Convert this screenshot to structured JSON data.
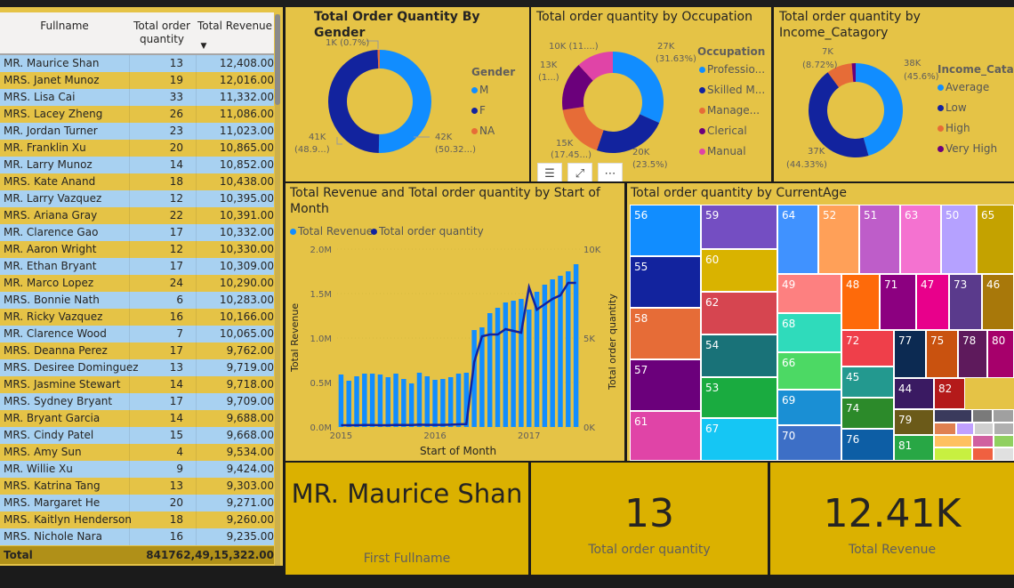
{
  "table": {
    "headers": {
      "name": "Fullname",
      "qty": "Total order quantity",
      "rev": "Total Revenue"
    },
    "rows": [
      [
        "MR. Maurice Shan",
        "13",
        "12,408.00"
      ],
      [
        "MRS. Janet Munoz",
        "19",
        "12,016.00"
      ],
      [
        "MRS. Lisa Cai",
        "33",
        "11,332.00"
      ],
      [
        "MRS. Lacey Zheng",
        "26",
        "11,086.00"
      ],
      [
        "MR. Jordan Turner",
        "23",
        "11,023.00"
      ],
      [
        "MR. Franklin Xu",
        "20",
        "10,865.00"
      ],
      [
        "MR. Larry Munoz",
        "14",
        "10,852.00"
      ],
      [
        "MRS. Kate Anand",
        "18",
        "10,438.00"
      ],
      [
        "MR. Larry Vazquez",
        "12",
        "10,395.00"
      ],
      [
        "MRS. Ariana Gray",
        "22",
        "10,391.00"
      ],
      [
        "MR. Clarence Gao",
        "17",
        "10,332.00"
      ],
      [
        "MR. Aaron Wright",
        "12",
        "10,330.00"
      ],
      [
        "MR. Ethan Bryant",
        "17",
        "10,309.00"
      ],
      [
        "MR. Marco Lopez",
        "24",
        "10,290.00"
      ],
      [
        "MRS. Bonnie Nath",
        "6",
        "10,283.00"
      ],
      [
        "MR. Ricky Vazquez",
        "16",
        "10,166.00"
      ],
      [
        "MR. Clarence Wood",
        "7",
        "10,065.00"
      ],
      [
        "MRS. Deanna Perez",
        "17",
        "9,762.00"
      ],
      [
        "MRS. Desiree Dominguez",
        "13",
        "9,719.00"
      ],
      [
        "MRS. Jasmine Stewart",
        "14",
        "9,718.00"
      ],
      [
        "MRS. Sydney Bryant",
        "17",
        "9,709.00"
      ],
      [
        "MR. Bryant Garcia",
        "14",
        "9,688.00"
      ],
      [
        "MRS. Cindy Patel",
        "15",
        "9,668.00"
      ],
      [
        "MRS. Amy Sun",
        "4",
        "9,534.00"
      ],
      [
        "MR. Willie Xu",
        "9",
        "9,424.00"
      ],
      [
        "MRS. Katrina Tang",
        "13",
        "9,303.00"
      ],
      [
        "MRS. Margaret He",
        "20",
        "9,271.00"
      ],
      [
        "MRS. Kaitlyn Henderson",
        "18",
        "9,260.00"
      ],
      [
        "MRS. Nichole Nara",
        "16",
        "9,235.00"
      ]
    ],
    "total": {
      "label": "Total",
      "qty": "84176",
      "rev": "2,49,15,322.00"
    }
  },
  "gender": {
    "title": "Total Order Quantity By Gender",
    "legend_title": "Gender",
    "legend": [
      {
        "name": "M",
        "color": "#118dff"
      },
      {
        "name": "F",
        "color": "#12239e"
      },
      {
        "name": "NA",
        "color": "#e66c37"
      }
    ],
    "labels": {
      "na": "1K (0.7%)",
      "f_val": "41K",
      "f_pct": "(48.9...)",
      "m_val": "42K",
      "m_pct": "(50.32...)"
    }
  },
  "occupation": {
    "title": "Total order quantity by Occupation",
    "legend_title": "Occupation",
    "legend": [
      {
        "name": "Professio...",
        "color": "#118dff"
      },
      {
        "name": "Skilled M...",
        "color": "#12239e"
      },
      {
        "name": "Manage...",
        "color": "#e66c37"
      },
      {
        "name": "Clerical",
        "color": "#6b007b"
      },
      {
        "name": "Manual",
        "color": "#e044a7"
      }
    ],
    "labels": {
      "a": "10K (11....)",
      "b1": "27K",
      "b2": "(31.63%)",
      "c1": "13K",
      "c2": "(1...)",
      "d1": "15K",
      "d2": "(17.45...)",
      "e1": "20K",
      "e2": "(23.5%)"
    }
  },
  "income": {
    "title": "Total order quantity by Income_Catagory",
    "legend_title": "Income_Cata...",
    "legend": [
      {
        "name": "Average",
        "color": "#118dff"
      },
      {
        "name": "Low",
        "color": "#12239e"
      },
      {
        "name": "High",
        "color": "#e66c37"
      },
      {
        "name": "Very High",
        "color": "#6b007b"
      }
    ],
    "labels": {
      "a1": "7K",
      "a2": "(8.72%)",
      "b1": "38K",
      "b2": "(45.6%)",
      "c1": "37K",
      "c2": "(44.33%)"
    }
  },
  "combo": {
    "title": "Total Revenue and Total order quantity by Start of Month",
    "legend": [
      {
        "name": "Total Revenue",
        "color": "#118dff"
      },
      {
        "name": "Total order quantity",
        "color": "#12239e"
      }
    ],
    "ylabel_left": "Total Revenue",
    "ylabel_right": "Total order quantity",
    "xlabel": "Start of Month",
    "left_ticks": [
      "2.0M",
      "1.5M",
      "1.0M",
      "0.5M",
      "0.0M"
    ],
    "right_ticks": [
      "10K",
      "5K",
      "0K"
    ],
    "x_ticks": [
      "2015",
      "2016",
      "2017"
    ]
  },
  "chart_data": {
    "type": "bar",
    "title": "Total Revenue and Total order quantity by Start of Month",
    "xlabel": "Start of Month",
    "ylabel": "Total Revenue",
    "ylim": [
      0,
      2000000
    ],
    "y2lim": [
      0,
      10000
    ],
    "x_ticks": [
      "2015",
      "2016",
      "2017"
    ],
    "series": [
      {
        "name": "Total Revenue",
        "type": "bar",
        "values": [
          590000,
          520000,
          570000,
          600000,
          600000,
          590000,
          560000,
          600000,
          540000,
          490000,
          610000,
          570000,
          530000,
          540000,
          560000,
          600000,
          610000,
          1090000,
          1120000,
          1280000,
          1340000,
          1400000,
          1420000,
          1440000,
          1320000,
          1520000,
          1600000,
          1660000,
          1700000,
          1750000,
          1830000
        ]
      },
      {
        "name": "Total order quantity",
        "type": "line",
        "values": [
          100,
          100,
          100,
          110,
          110,
          100,
          100,
          120,
          110,
          110,
          130,
          120,
          120,
          120,
          130,
          150,
          160,
          3650,
          5100,
          5200,
          5200,
          5500,
          5400,
          5300,
          7850,
          6600,
          6900,
          7200,
          7400,
          8100,
          8100
        ]
      }
    ]
  },
  "age": {
    "title": "Total order quantity by CurrentAge",
    "cells": [
      {
        "label": "56",
        "color": "#118dff"
      },
      {
        "label": "55",
        "color": "#12239e"
      },
      {
        "label": "58",
        "color": "#e66c37"
      },
      {
        "label": "57",
        "color": "#6b007b"
      },
      {
        "label": "61",
        "color": "#e044a7"
      },
      {
        "label": "59",
        "color": "#744ec2"
      },
      {
        "label": "60",
        "color": "#d9b300"
      },
      {
        "label": "62",
        "color": "#d64550"
      },
      {
        "label": "54",
        "color": "#197278"
      },
      {
        "label": "53",
        "color": "#1aab40"
      },
      {
        "label": "67",
        "color": "#15c6f4"
      },
      {
        "label": "64",
        "color": "#4092ff"
      },
      {
        "label": "52",
        "color": "#ffa058"
      },
      {
        "label": "51",
        "color": "#be5dc9"
      },
      {
        "label": "63",
        "color": "#f472d0"
      },
      {
        "label": "50",
        "color": "#b5a1ff"
      },
      {
        "label": "65",
        "color": "#c4a200"
      },
      {
        "label": "49",
        "color": "#fd8080"
      },
      {
        "label": "48",
        "color": "#fe6a0a"
      },
      {
        "label": "71",
        "color": "#8c0080"
      },
      {
        "label": "47",
        "color": "#e8008b"
      },
      {
        "label": "73",
        "color": "#5a3a8c"
      },
      {
        "label": "46",
        "color": "#a8780a"
      },
      {
        "label": "68",
        "color": "#2fdbbb"
      },
      {
        "label": "66",
        "color": "#4cd964"
      },
      {
        "label": "69",
        "color": "#1a8fd4"
      },
      {
        "label": "70",
        "color": "#3d6fc6"
      },
      {
        "label": "72",
        "color": "#ef3f4a"
      },
      {
        "label": "77",
        "color": "#0c2a52"
      },
      {
        "label": "75",
        "color": "#c9520f"
      },
      {
        "label": "78",
        "color": "#5e1a5c"
      },
      {
        "label": "80",
        "color": "#a6006b"
      },
      {
        "label": "45",
        "color": "#23998f"
      },
      {
        "label": "74",
        "color": "#2c8a2a"
      },
      {
        "label": "44",
        "color": "#3a1a62"
      },
      {
        "label": "82",
        "color": "#b41a1a"
      },
      {
        "label": "76",
        "color": "#0d5ea5"
      },
      {
        "label": "79",
        "color": "#6b5a19"
      },
      {
        "label": "81",
        "color": "#28a745"
      }
    ]
  },
  "cards": {
    "name_value": "MR. Maurice Shan",
    "name_label": "First Fullname",
    "qty_value": "13",
    "qty_label": "Total order quantity",
    "rev_value": "12.41K",
    "rev_label": "Total Revenue"
  },
  "visual_icons": [
    "filter-icon",
    "focus-mode-icon",
    "more-options-icon"
  ]
}
